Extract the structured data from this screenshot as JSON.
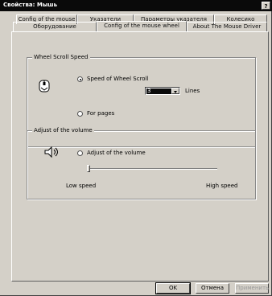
{
  "window": {
    "title": "Свойства: Мышь",
    "help_label": "?"
  },
  "tabs_back": [
    {
      "label": "Config of the mouse"
    },
    {
      "label": "Указатели"
    },
    {
      "label": "Параметры указателя"
    },
    {
      "label": "Колесико"
    }
  ],
  "tabs_front": [
    {
      "label": "Оборудование"
    },
    {
      "label": "Config of the mouse wheel",
      "active": true
    },
    {
      "label": "About The Mouse Driver"
    }
  ],
  "wheel_group": {
    "title": "Wheel Scroll Speed",
    "icon": "mouse-wheel-icon",
    "speed_option": {
      "label": "Speed of Wheel Scroll",
      "checked": true
    },
    "lines_select": {
      "value": "3"
    },
    "lines_label": "Lines",
    "pages_option": {
      "label": "For pages",
      "checked": false
    }
  },
  "volume_group": {
    "title": "Adjust of the volume",
    "icon": "speaker-hand-icon",
    "adjust_option": {
      "label": "Adjust of the volume",
      "checked": false
    },
    "slider_level": 0.0,
    "low_label": "Low speed",
    "high_label": "High speed"
  },
  "buttons": {
    "ok": "OK",
    "cancel": "Отмена",
    "apply": "Применить"
  }
}
